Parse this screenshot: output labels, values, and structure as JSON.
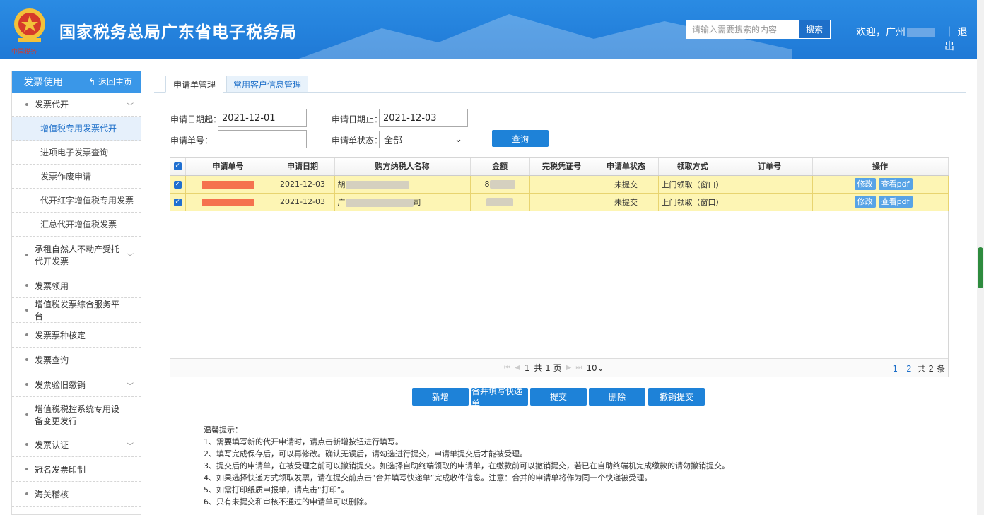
{
  "header": {
    "title": "国家税务总局广东省电子税务局",
    "search_placeholder": "请输入需要搜索的内容",
    "search_label": "搜索",
    "welcome": "欢迎，广州",
    "logout": "｜ 退出"
  },
  "sidebar": {
    "title": "发票使用",
    "back": "返回主页",
    "items": [
      {
        "label": "发票代开",
        "expand": true
      },
      {
        "label": "增值税专用发票代开",
        "sub": true,
        "active": true
      },
      {
        "label": "进项电子发票查询",
        "sub": true
      },
      {
        "label": "发票作废申请",
        "sub": true
      },
      {
        "label": "代开红字增值税专用发票",
        "sub": true
      },
      {
        "label": "汇总代开增值税发票",
        "sub": true
      },
      {
        "label": "承租自然人不动产受托代开发票",
        "expand": true
      },
      {
        "label": "发票领用"
      },
      {
        "label": "增值税发票综合服务平台"
      },
      {
        "label": "发票票种核定"
      },
      {
        "label": "发票查询"
      },
      {
        "label": "发票验旧缴销",
        "expand": true
      },
      {
        "label": "增值税税控系统专用设备变更发行"
      },
      {
        "label": "发票认证",
        "expand": true
      },
      {
        "label": "冠名发票印制"
      },
      {
        "label": "海关稽核"
      }
    ]
  },
  "tabs": [
    "申请单管理",
    "常用客户信息管理"
  ],
  "filters": {
    "start_label": "申请日期起：",
    "start_value": "2021-12-01",
    "end_label": "申请日期止：",
    "end_value": "2021-12-03",
    "no_label": "申请单号：",
    "no_value": "",
    "status_label": "申请单状态：",
    "status_value": "全部",
    "query": "查询"
  },
  "table": {
    "columns": [
      "申请单号",
      "申请日期",
      "购方纳税人名称",
      "金额",
      "完税凭证号",
      "申请单状态",
      "领取方式",
      "订单号",
      "操作"
    ],
    "rows": [
      {
        "no_prefix": "",
        "date": "2021-12-03",
        "name_prefix": "胡",
        "name_suffix": "",
        "amount_prefix": "8",
        "status": "未提交",
        "method": "上门领取（窗口）",
        "order": "",
        "edit": "修改",
        "pdf": "查看pdf"
      },
      {
        "no_prefix": "",
        "date": "2021-12-03",
        "name_prefix": "广",
        "name_suffix": "司",
        "amount_prefix": "",
        "status": "未提交",
        "method": "上门领取（窗口）",
        "order": "",
        "edit": "修改",
        "pdf": "查看pdf"
      }
    ],
    "pager": {
      "page": "1",
      "total_pages": "共 1 页",
      "page_size": "10",
      "range": "1 - 2",
      "total": "共 2 条"
    }
  },
  "actions": [
    "新增",
    "合并填写快递单",
    "提交",
    "删除",
    "撤销提交"
  ],
  "tips": [
    "温馨提示：",
    "1、需要填写新的代开申请时，请点击新增按钮进行填写。",
    "2、填写完成保存后，可以再修改。确认无误后，请勾选进行提交，申请单提交后才能被受理。",
    "3、提交后的申请单，在被受理之前可以撤销提交。如选择自助终端领取的申请单，在缴款前可以撤销提交，若已在自助终端机完成缴款的请勿撤销提交。",
    "4、如果选择快递方式领取发票，请在提交前点击“合并填写快递单”完成收件信息。注意：合并的申请单将作为同一个快递被受理。",
    "5、如需打印纸质申报单，请点击“打印”。",
    "6、只有未提交和审核不通过的申请单可以删除。"
  ]
}
